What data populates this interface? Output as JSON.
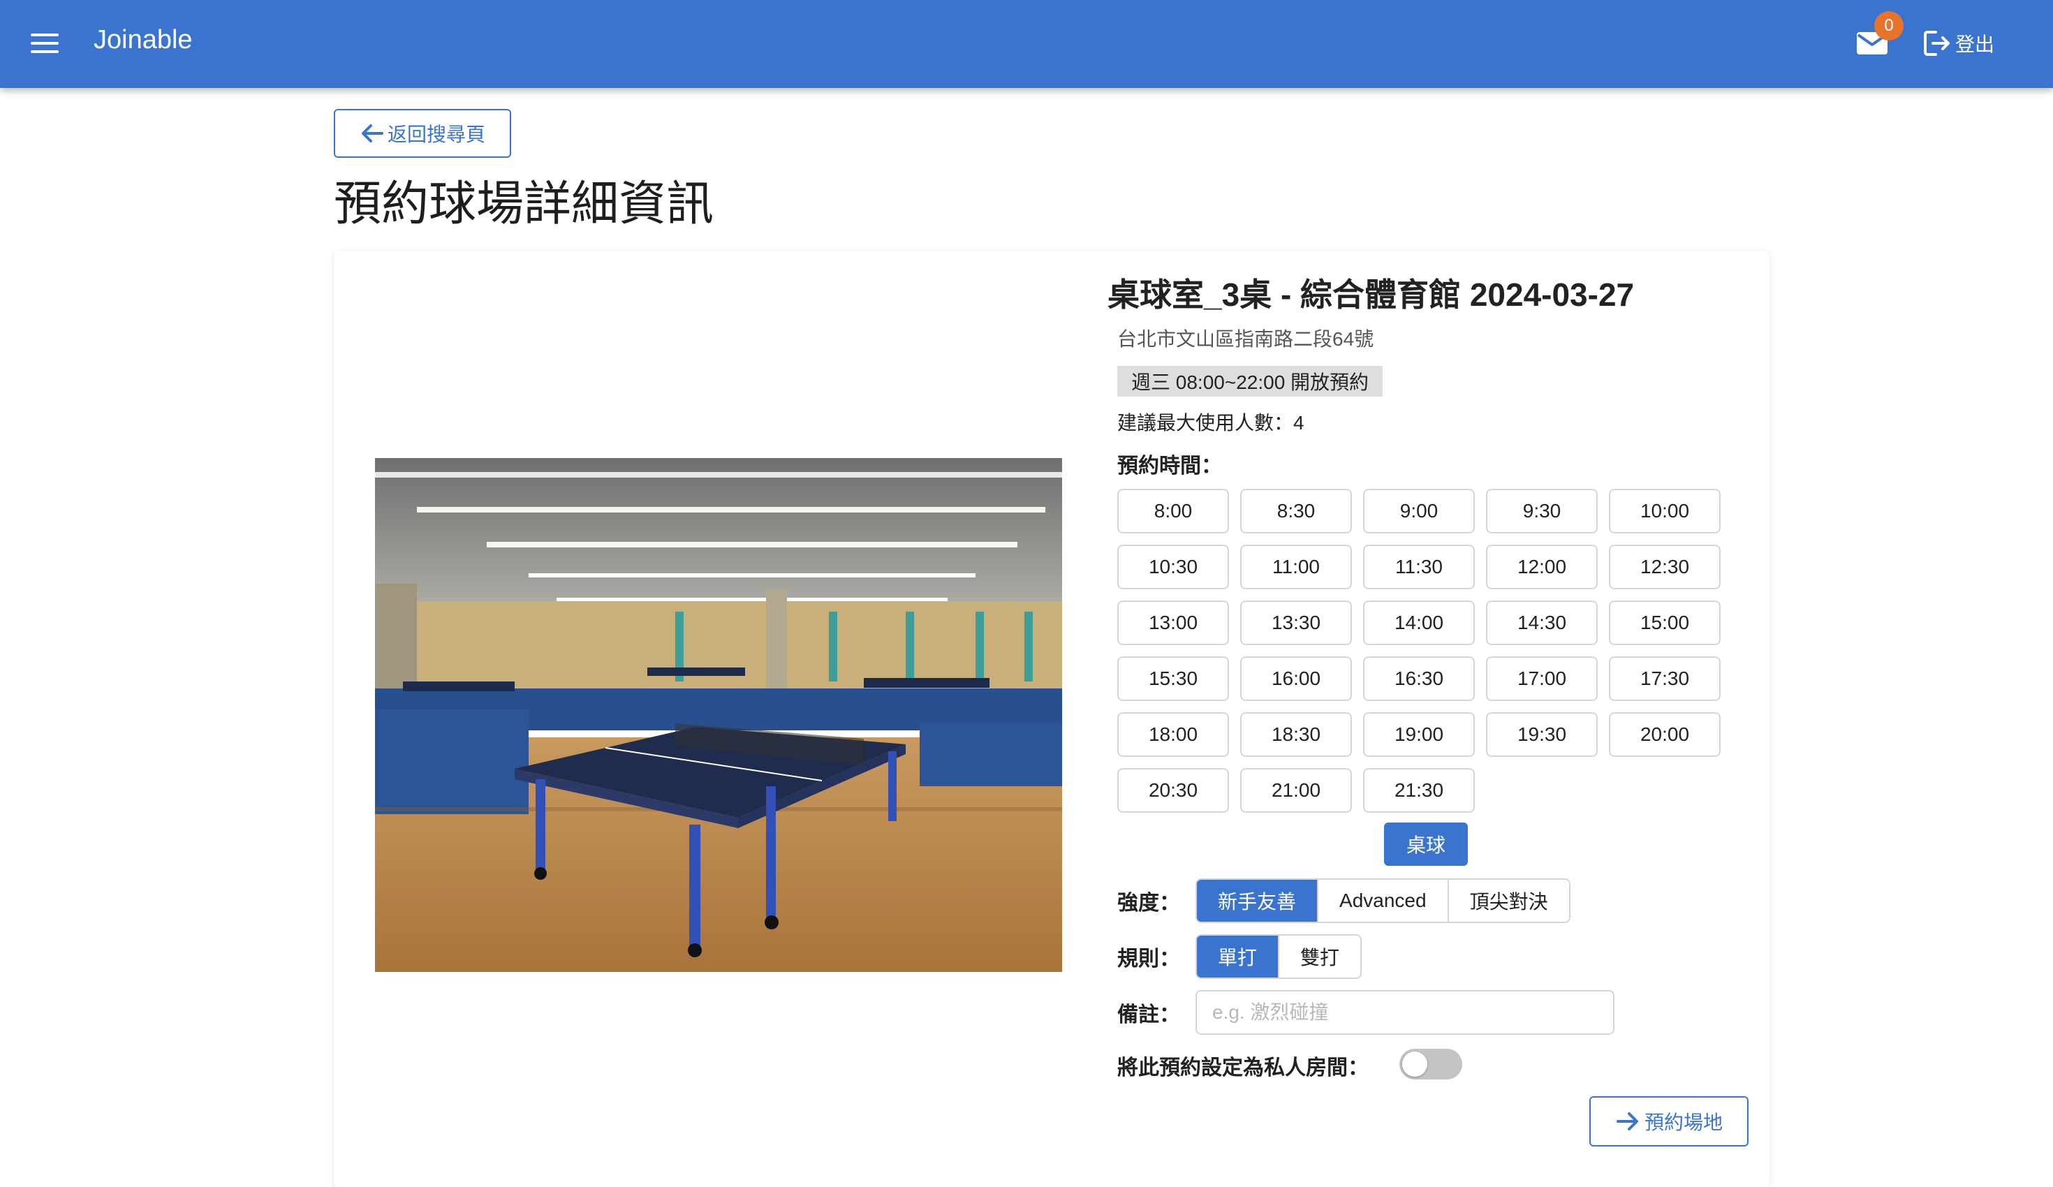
{
  "appbar": {
    "title": "Joinable",
    "menu_icon": "menu-icon",
    "mail_icon": "mail-icon",
    "notification_count": "0",
    "logout_label": "登出",
    "logout_icon": "logout-icon"
  },
  "header": {
    "back_label": "返回搜尋頁",
    "back_icon": "arrow-left-icon",
    "page_title": "預約球場詳細資訊"
  },
  "venue": {
    "title": "桌球室_3桌 - 綜合體育館 2024-03-27",
    "address": "台北市文山區指南路二段64號",
    "open_hours": "週三 08:00~22:00 開放預約",
    "max_people": "建議最大使用人數：4",
    "photo": "table-tennis-room-photo"
  },
  "booking": {
    "time_label": "預約時間：",
    "time_slots": [
      "8:00",
      "8:30",
      "9:00",
      "9:30",
      "10:00",
      "10:30",
      "11:00",
      "11:30",
      "12:00",
      "12:30",
      "13:00",
      "13:30",
      "14:00",
      "14:30",
      "15:00",
      "15:30",
      "16:00",
      "16:30",
      "17:00",
      "17:30",
      "18:00",
      "18:30",
      "19:00",
      "19:30",
      "20:00",
      "20:30",
      "21:00",
      "21:30"
    ],
    "sport_label": "桌球",
    "intensity_label": "強度：",
    "intensity_options": [
      "新手友善",
      "Advanced",
      "頂尖對決"
    ],
    "intensity_selected": "新手友善",
    "rule_label": "規則：",
    "rule_options": [
      "單打",
      "雙打"
    ],
    "rule_selected": "單打",
    "note_label": "備註：",
    "note_placeholder": "e.g. 激烈碰撞",
    "note_value": "",
    "private_label": "將此預約設定為私人房間：",
    "private_enabled": false,
    "reserve_label": "預約場地",
    "reserve_icon": "arrow-right-icon"
  },
  "colors": {
    "primary": "#3a74cf",
    "badge": "#e8732a",
    "toggle_off": "#c4c4c4"
  }
}
